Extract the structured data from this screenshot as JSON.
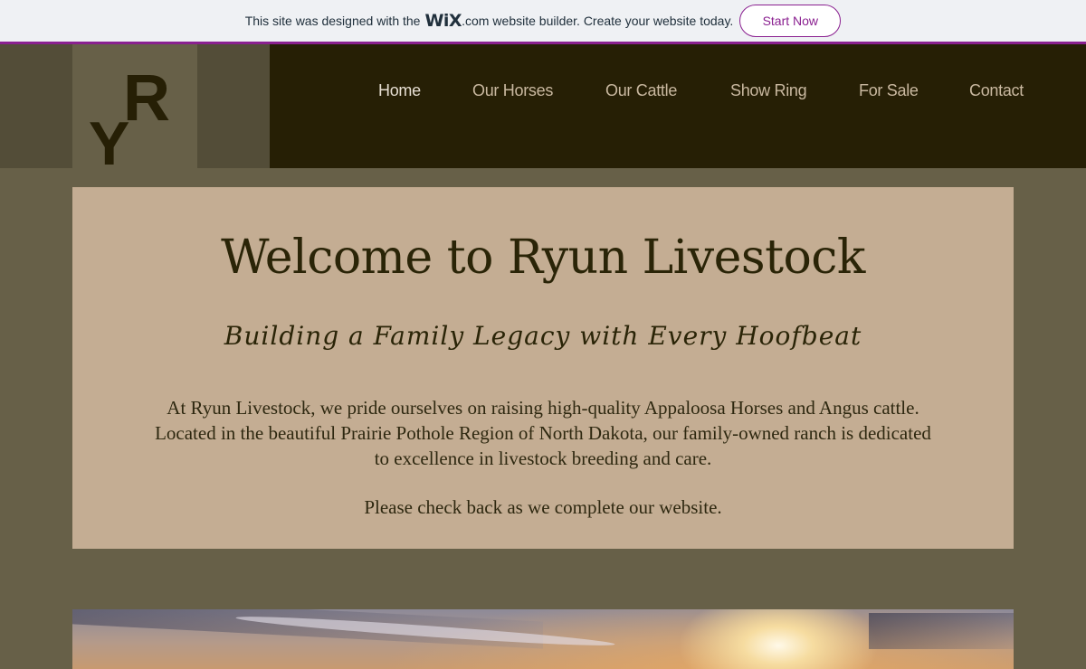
{
  "wix_banner": {
    "text_before": "This site was designed with the",
    "logo": "WiX",
    "dotcom": ".com",
    "text_after": "website builder. Create your website today.",
    "button_label": "Start Now"
  },
  "logo": {
    "letter_top": "R",
    "letter_bottom": "Y"
  },
  "nav": {
    "items": [
      {
        "label": "Home"
      },
      {
        "label": "Our Horses"
      },
      {
        "label": "Our Cattle"
      },
      {
        "label": "Show Ring"
      },
      {
        "label": "For Sale"
      },
      {
        "label": "Contact"
      }
    ],
    "active": "Home"
  },
  "main": {
    "title": "Welcome to Ryun Livestock",
    "tagline": "Building a Family Legacy with Every Hoofbeat",
    "intro_lines": [
      "At Ryun Livestock, we pride ourselves on raising high-quality Appaloosa Horses and Angus cattle.",
      "Located in the beautiful Prairie Pothole Region of North Dakota, our family-owned ranch is dedicated",
      "to excellence in livestock breeding and care."
    ],
    "note": "Please check back as we complete our website."
  },
  "colors": {
    "accent": "#8a2090",
    "page_bg": "#676048",
    "header_dark": "#261f05",
    "card_bg": "#c4ad93",
    "nav_text": "#c9b8a0"
  }
}
